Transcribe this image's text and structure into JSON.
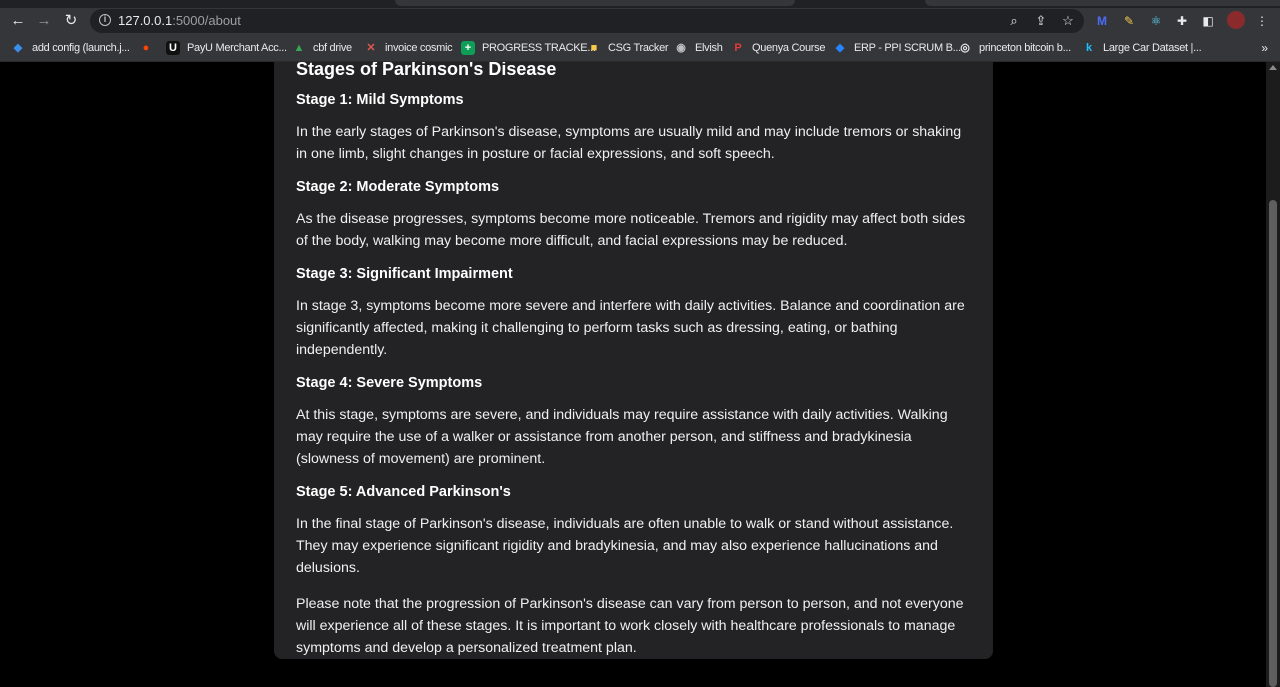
{
  "browser": {
    "url_host": "127.0.0.1",
    "url_path": ":5000/about"
  },
  "bookmarks": [
    {
      "label": "add config (launch.j...",
      "icon": "vscode-icon",
      "color": "#3b8eea",
      "glyph": "◆"
    },
    {
      "label": "",
      "icon": "reddit-icon",
      "color": "#ff4500",
      "glyph": "●"
    },
    {
      "label": "PayU Merchant Acc...",
      "icon": "payu-icon",
      "color": "#ffffff",
      "glyph": "U"
    },
    {
      "label": "cbf drive",
      "icon": "google-drive-icon",
      "color": "#34a853",
      "glyph": "▲"
    },
    {
      "label": "invoice cosmic",
      "icon": "invoice-icon",
      "color": "#e0574f",
      "glyph": "✕"
    },
    {
      "label": "PROGRESS TRACKE...",
      "icon": "sheets-icon",
      "color": "#0f9d58",
      "glyph": "+"
    },
    {
      "label": "CSG Tracker",
      "icon": "folder-icon",
      "color": "#f6c94c",
      "glyph": "■"
    },
    {
      "label": "Elvish",
      "icon": "elvish-icon",
      "color": "#bdc1c6",
      "glyph": "◉"
    },
    {
      "label": "Quenya Course",
      "icon": "quenya-icon",
      "color": "#e53935",
      "glyph": "P"
    },
    {
      "label": "ERP - PPI SCRUM B...",
      "icon": "jira-icon",
      "color": "#2684ff",
      "glyph": "◆"
    },
    {
      "label": "princeton bitcoin b...",
      "icon": "princeton-icon",
      "color": "#e8eaed",
      "glyph": "◎"
    },
    {
      "label": "Large Car Dataset |...",
      "icon": "kaggle-icon",
      "color": "#20beff",
      "glyph": "k"
    }
  ],
  "page": {
    "title": "Stages of Parkinson's Disease",
    "stages": [
      {
        "heading": "Stage 1: Mild Symptoms",
        "text": "In the early stages of Parkinson's disease, symptoms are usually mild and may include tremors or shaking in one limb, slight changes in posture or facial expressions, and soft speech."
      },
      {
        "heading": "Stage 2: Moderate Symptoms",
        "text": "As the disease progresses, symptoms become more noticeable. Tremors and rigidity may affect both sides of the body, walking may become more difficult, and facial expressions may be reduced."
      },
      {
        "heading": "Stage 3: Significant Impairment",
        "text": "In stage 3, symptoms become more severe and interfere with daily activities. Balance and coordination are significantly affected, making it challenging to perform tasks such as dressing, eating, or bathing independently."
      },
      {
        "heading": "Stage 4: Severe Symptoms",
        "text": "At this stage, symptoms are severe, and individuals may require assistance with daily activities. Walking may require the use of a walker or assistance from another person, and stiffness and bradykinesia (slowness of movement) are prominent."
      },
      {
        "heading": "Stage 5: Advanced Parkinson's",
        "text": "In the final stage of Parkinson's disease, individuals are often unable to walk or stand without assistance. They may experience significant rigidity and bradykinesia, and may also experience hallucinations and delusions."
      }
    ],
    "note": "Please note that the progression of Parkinson's disease can vary from person to person, and not everyone will experience all of these stages. It is important to work closely with healthcare professionals to manage symptoms and develop a personalized treatment plan."
  }
}
